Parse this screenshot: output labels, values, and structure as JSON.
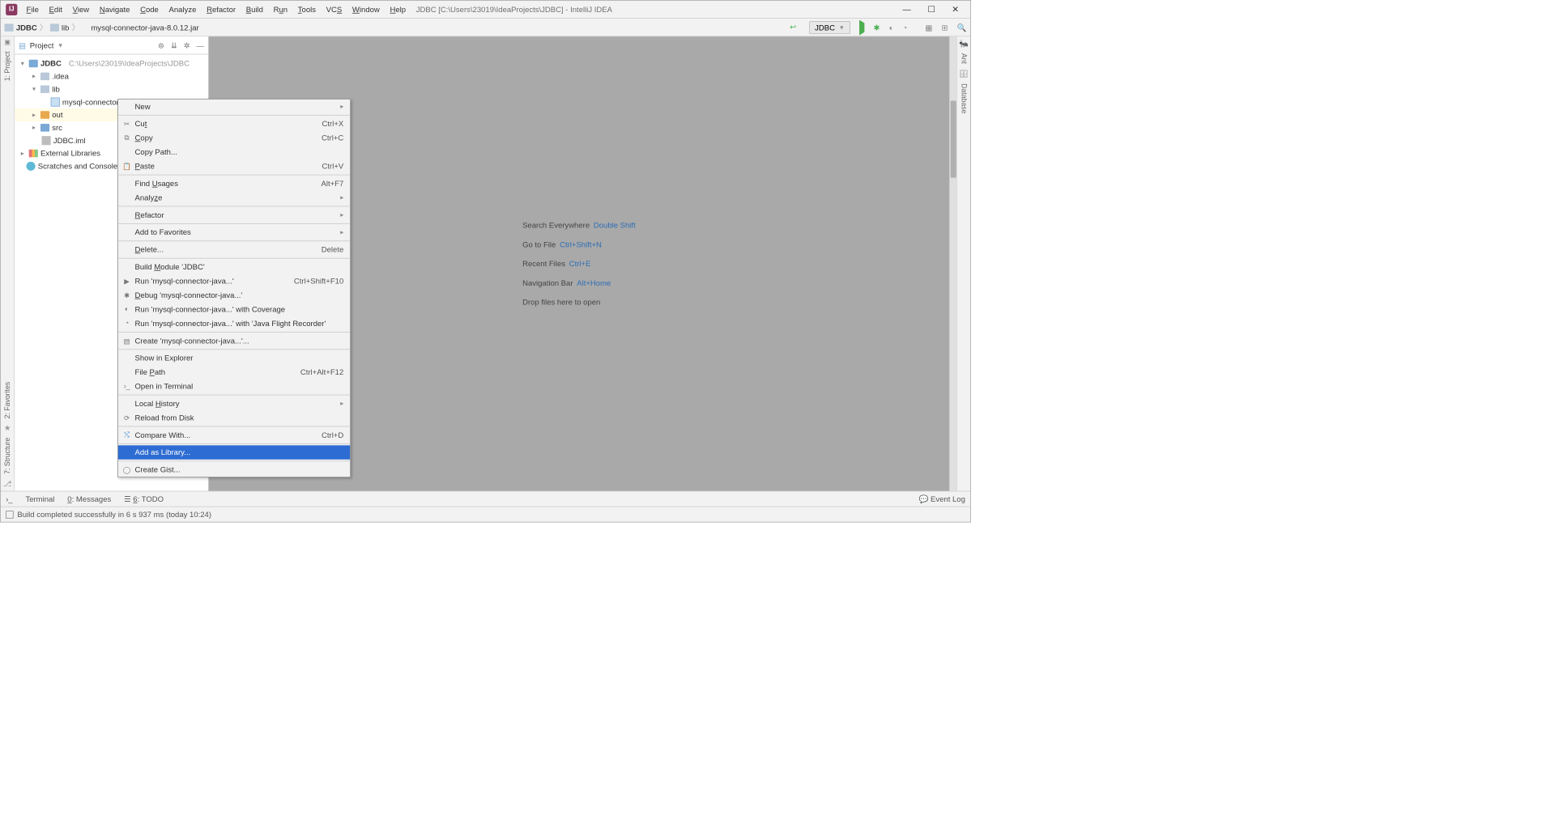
{
  "window_title": "JDBC [C:\\Users\\23019\\IdeaProjects\\JDBC] - IntelliJ IDEA",
  "menu": {
    "file": "File",
    "edit": "Edit",
    "view": "View",
    "navigate": "Navigate",
    "code": "Code",
    "analyze": "Analyze",
    "refactor": "Refactor",
    "build": "Build",
    "run": "Run",
    "tools": "Tools",
    "vcs": "VCS",
    "window": "Window",
    "help": "Help"
  },
  "breadcrumb": {
    "project": "JDBC",
    "folder": "lib",
    "file": "mysql-connector-java-8.0.12.jar"
  },
  "run_config": {
    "name": "JDBC"
  },
  "project_tool": {
    "title": "Project"
  },
  "tree": {
    "root": {
      "name": "JDBC",
      "path": "C:\\Users\\23019\\IdeaProjects\\JDBC"
    },
    "idea": ".idea",
    "lib": "lib",
    "jar": "mysql-connector-java-8.0.12.jar",
    "out": "out",
    "src": "src",
    "iml": "JDBC.iml",
    "external": "External Libraries",
    "scratches": "Scratches and Consoles"
  },
  "tips": {
    "search": {
      "label": "Search Everywhere",
      "shortcut": "Double Shift"
    },
    "goto": {
      "label": "Go to File",
      "shortcut": "Ctrl+Shift+N"
    },
    "recent": {
      "label": "Recent Files",
      "shortcut": "Ctrl+E"
    },
    "nav": {
      "label": "Navigation Bar",
      "shortcut": "Alt+Home"
    },
    "drop": "Drop files here to open"
  },
  "context_menu": {
    "new": "New",
    "cut": {
      "label": "Cut",
      "sc": "Ctrl+X"
    },
    "copy": {
      "label": "Copy",
      "sc": "Ctrl+C"
    },
    "copy_path": "Copy Path...",
    "paste": {
      "label": "Paste",
      "sc": "Ctrl+V"
    },
    "find_usages": {
      "label": "Find Usages",
      "sc": "Alt+F7"
    },
    "analyze": "Analyze",
    "refactor": "Refactor",
    "add_fav": "Add to Favorites",
    "delete": {
      "label": "Delete...",
      "sc": "Delete"
    },
    "build_module": "Build Module 'JDBC'",
    "run": {
      "label": "Run 'mysql-connector-java...'",
      "sc": "Ctrl+Shift+F10"
    },
    "debug": "Debug 'mysql-connector-java...'",
    "run_cov": "Run 'mysql-connector-java...' with Coverage",
    "run_jfr": "Run 'mysql-connector-java...' with 'Java Flight Recorder'",
    "create": "Create 'mysql-connector-java...'...",
    "show_explorer": "Show in Explorer",
    "file_path": {
      "label": "File Path",
      "sc": "Ctrl+Alt+F12"
    },
    "open_terminal": "Open in Terminal",
    "local_history": "Local History",
    "reload": "Reload from Disk",
    "compare": {
      "label": "Compare With...",
      "sc": "Ctrl+D"
    },
    "add_library": "Add as Library...",
    "create_gist": "Create Gist..."
  },
  "left_gutter": {
    "project": "1: Project",
    "favorites": "2: Favorites",
    "structure": "7: Structure"
  },
  "right_gutter": {
    "ant": "Ant",
    "database": "Database"
  },
  "bottom_bar": {
    "terminal": "Terminal",
    "messages": "0: Messages",
    "todo": "6: TODO",
    "event_log": "Event Log"
  },
  "status": "Build completed successfully in 6 s 937 ms (today 10:24)"
}
